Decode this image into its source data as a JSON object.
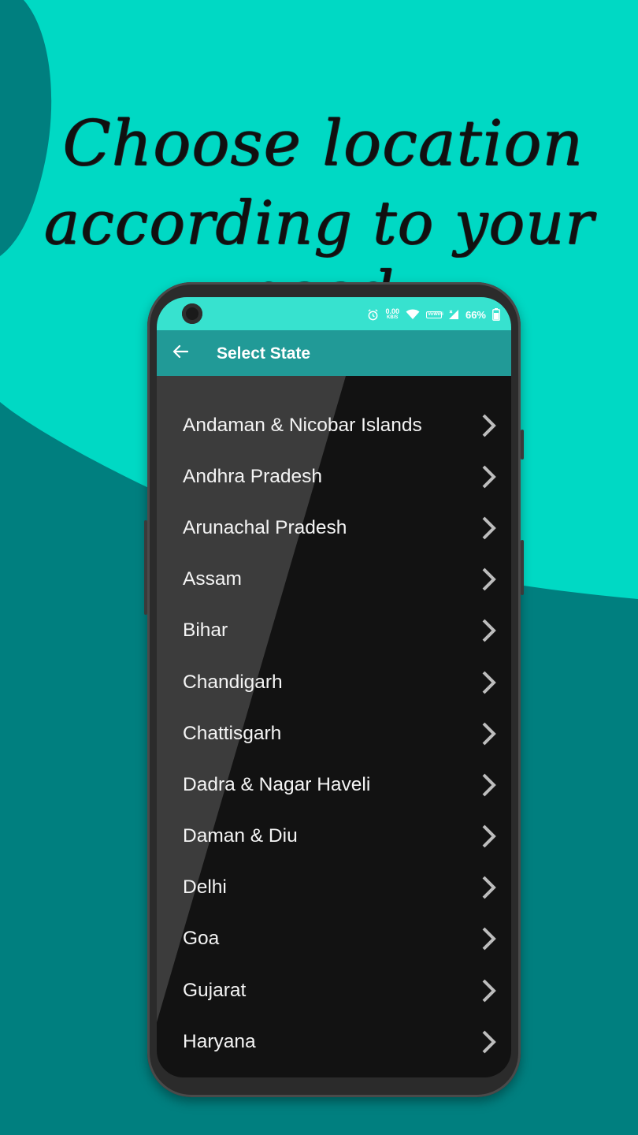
{
  "headline": {
    "line1": "Choose location",
    "line2": "according to your need"
  },
  "colors": {
    "background_dark": "#007f7f",
    "background_light": "#00d9c4",
    "statusbar": "#37e2cf",
    "appbar": "#219a97",
    "list_background": "#121212"
  },
  "statusbar": {
    "speed_value": "0.00",
    "speed_unit": "KB/S",
    "network_label": "VoWiFi",
    "battery": "66%",
    "icons": [
      "alarm-icon",
      "wifi-icon",
      "vowifi-icon",
      "signal-icon",
      "battery-icon"
    ]
  },
  "appbar": {
    "title": "Select State",
    "back_icon": "arrow-left-icon"
  },
  "states": [
    {
      "label": "Andaman & Nicobar Islands"
    },
    {
      "label": "Andhra Pradesh"
    },
    {
      "label": "Arunachal Pradesh"
    },
    {
      "label": "Assam"
    },
    {
      "label": "Bihar"
    },
    {
      "label": "Chandigarh"
    },
    {
      "label": "Chattisgarh"
    },
    {
      "label": "Dadra & Nagar Haveli"
    },
    {
      "label": "Daman & Diu"
    },
    {
      "label": "Delhi"
    },
    {
      "label": "Goa"
    },
    {
      "label": "Gujarat"
    },
    {
      "label": "Haryana"
    }
  ]
}
